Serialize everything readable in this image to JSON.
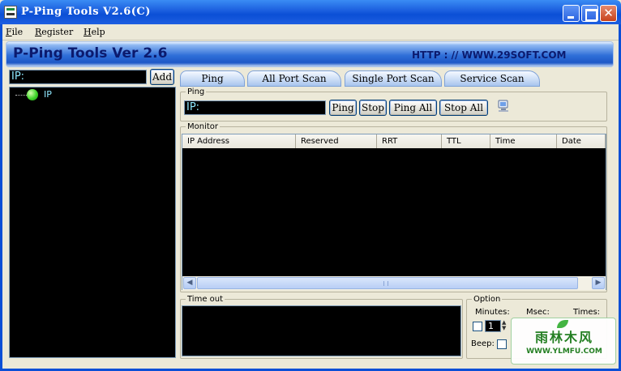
{
  "window": {
    "title": "P-Ping Tools V2.6(C)",
    "close_glyph": "✕",
    "controls": [
      "minimize-icon",
      "maximize-icon",
      "close-icon"
    ]
  },
  "menu": {
    "items": [
      {
        "underline": "F",
        "rest": "ile"
      },
      {
        "underline": "R",
        "rest": "egister"
      },
      {
        "underline": "H",
        "rest": "elp"
      }
    ]
  },
  "banner": {
    "app_name": "P-Ping Tools Ver 2.6",
    "site": "HTTP : // WWW.29SOFT.COM"
  },
  "left": {
    "ip_input_value": "IP:",
    "add_label": "Add",
    "tree_node_label": "IP"
  },
  "tabs": [
    "Ping",
    "All Port Scan",
    "Single Port Scan",
    "Service Scan"
  ],
  "ping": {
    "group_label": "Ping",
    "ip_value": "IP:",
    "buttons": [
      "Ping",
      "Stop",
      "Ping All",
      "Stop All"
    ]
  },
  "monitor": {
    "group_label": "Monitor",
    "columns": [
      "IP Address",
      "Reserved",
      "RRT",
      "TTL",
      "Time",
      "Date"
    ],
    "rows": []
  },
  "timeout": {
    "group_label": "Time out"
  },
  "option": {
    "group_label": "Option",
    "minutes_label": "Minutes:",
    "msec_label": "Msec:",
    "times_label": "Times:",
    "minutes_value": "1",
    "beep_label": "Beep:"
  },
  "watermark": {
    "text": "雨林木风",
    "url": "WWW.YLMFU.COM"
  },
  "colors": {
    "titlebar": "#0b4fd6",
    "panel_bg": "#000000",
    "text_cyan": "#8fe8ff",
    "node_green": "#3fd62a"
  }
}
